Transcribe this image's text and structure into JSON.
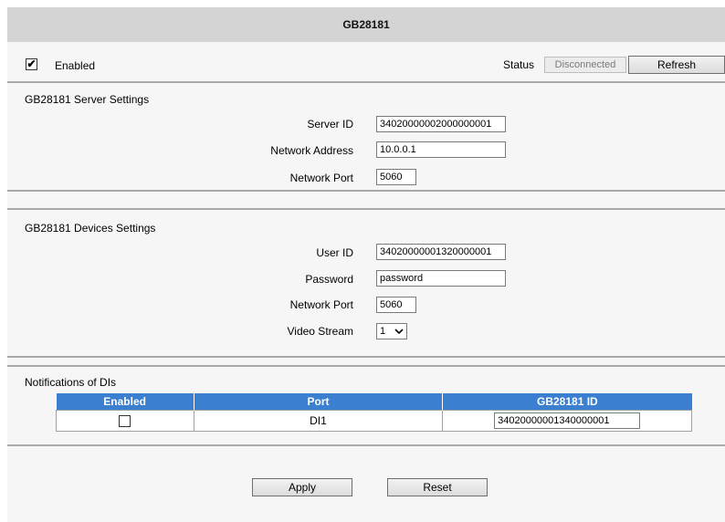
{
  "window": {
    "title": "GB28181"
  },
  "top": {
    "enabled_label": "Enabled",
    "enabled_checked": true,
    "status_label": "Status",
    "status_value": "Disconnected",
    "refresh_label": "Refresh"
  },
  "server_settings": {
    "heading": "GB28181 Server Settings",
    "server_id_label": "Server ID",
    "server_id_value": "34020000002000000001",
    "network_address_label": "Network Address",
    "network_address_value": "10.0.0.1",
    "network_port_label": "Network Port",
    "network_port_value": "5060"
  },
  "device_settings": {
    "heading": "GB28181 Devices Settings",
    "user_id_label": "User ID",
    "user_id_value": "34020000001320000001",
    "password_label": "Password",
    "password_value": "password",
    "network_port_label": "Network Port",
    "network_port_value": "5060",
    "video_stream_label": "Video Stream",
    "video_stream_value": "1"
  },
  "notifications": {
    "heading": "Notifications of DIs",
    "columns": [
      "Enabled",
      "Port",
      "GB28181 ID"
    ],
    "rows": [
      {
        "enabled": false,
        "port": "DI1",
        "gb_id": "34020000001340000001"
      }
    ]
  },
  "actions": {
    "apply_label": "Apply",
    "reset_label": "Reset"
  },
  "colors": {
    "header_blue": "#3a7fd0",
    "title_bar": "#d4d4d4",
    "panel": "#f6f6f6"
  }
}
